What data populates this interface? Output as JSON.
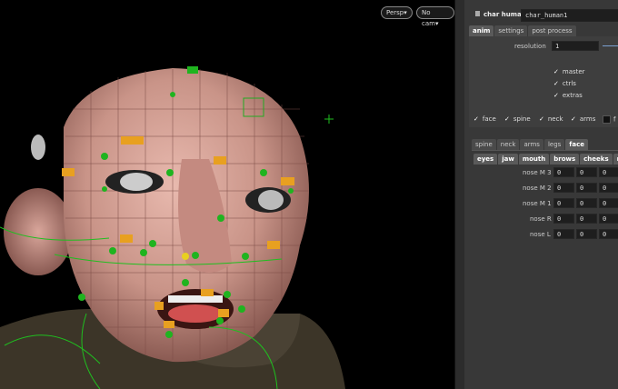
{
  "viewport": {
    "persp_label": "Persp▾",
    "cam_label": "No cam▾"
  },
  "panel": {
    "title": "char human",
    "name_value": "char_human1",
    "top_tabs": [
      "anim",
      "settings",
      "post process"
    ],
    "resolution_label": "resolution",
    "resolution_value": "1",
    "checks": [
      "master",
      "ctrls",
      "extras"
    ],
    "part_checks": [
      "face",
      "spine",
      "neck",
      "arms",
      "f"
    ],
    "section_tabs": [
      "spine",
      "neck",
      "arms",
      "legs",
      "face"
    ],
    "sub_tabs": [
      "eyes",
      "jaw",
      "mouth",
      "brows",
      "cheeks",
      "no"
    ],
    "nose_rows": [
      {
        "label": "nose M 3",
        "values": [
          "0",
          "0",
          "0"
        ]
      },
      {
        "label": "nose M 2",
        "values": [
          "0",
          "0",
          "0"
        ]
      },
      {
        "label": "nose M 1",
        "values": [
          "0",
          "0",
          "0"
        ]
      },
      {
        "label": "nose R",
        "values": [
          "0",
          "0",
          "0"
        ]
      },
      {
        "label": "nose L",
        "values": [
          "0",
          "0",
          "0"
        ]
      }
    ]
  }
}
